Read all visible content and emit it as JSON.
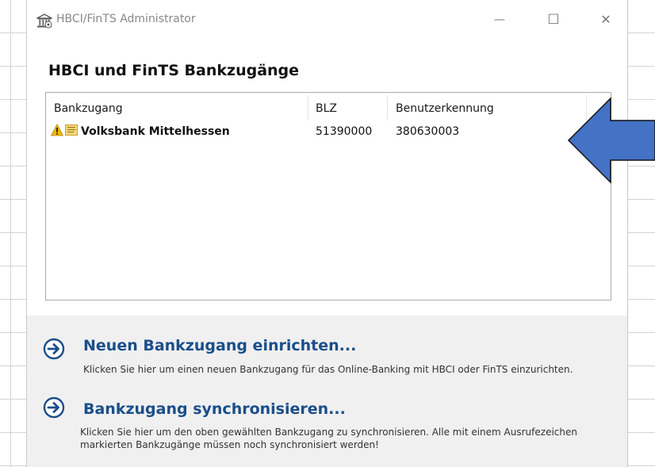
{
  "window": {
    "title": "HBCI/FinTS Administrator",
    "minimize": "—",
    "maximize": "☐",
    "close": "✕"
  },
  "heading": "HBCI und FinTS Bankzugänge",
  "list": {
    "columns": [
      "Bankzugang",
      "BLZ",
      "Benutzerkennung"
    ],
    "rows": [
      {
        "name": "Volksbank Mittelhessen",
        "blz": "51390000",
        "user": "380630003"
      }
    ]
  },
  "actions": [
    {
      "title": "Neuen Bankzugang einrichten...",
      "description": "Klicken Sie hier um einen neuen Bankzugang für das Online-Banking mit HBCI oder FinTS einzurichten."
    },
    {
      "title": "Bankzugang synchronisieren...",
      "description": "Klicken Sie hier um den oben gewählten Bankzugang zu synchronisieren. Alle mit einem Ausrufezeichen markierten Bankzugänge müssen noch synchronisiert werden!"
    }
  ],
  "colors": {
    "accent": "#1a4e8a",
    "callout_arrow": "#4472c4",
    "warning": "#f2b705"
  },
  "icons": [
    "bank-icon",
    "warning-icon",
    "document-icon",
    "arrow-right-circle-icon",
    "callout-arrow-icon"
  ]
}
